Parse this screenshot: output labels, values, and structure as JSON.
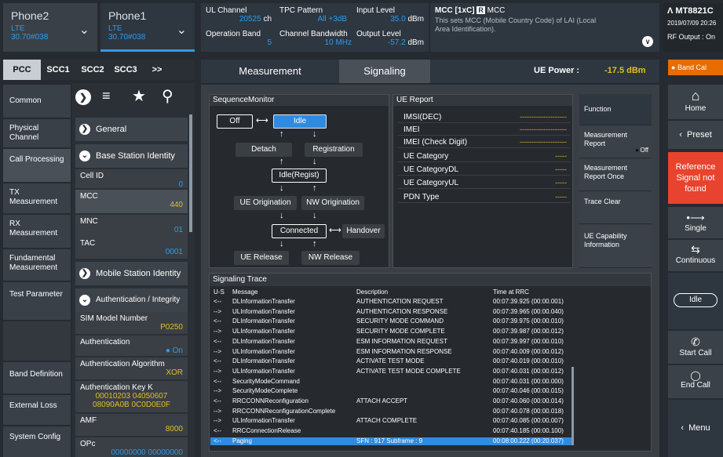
{
  "phones": [
    {
      "name": "Phone2",
      "rat": "LTE",
      "band": "30.70#038"
    },
    {
      "name": "Phone1",
      "rat": "LTE",
      "band": "30.70#038"
    }
  ],
  "header": {
    "ul_channel_label": "UL Channel",
    "ul_channel_value": "20525",
    "ul_channel_unit": "ch",
    "operation_band_label": "Operation Band",
    "operation_band_value": "5",
    "tpc_label": "TPC Pattern",
    "tpc_value": "All +3dB",
    "ch_bw_label": "Channel Bandwidth",
    "ch_bw_value": "10 MHz",
    "input_level_label": "Input Level",
    "input_level_value": "35.0",
    "input_level_unit": "dBm",
    "output_level_label": "Output Level",
    "output_level_value": "-57.2",
    "output_level_unit": "dBm",
    "help_title": "MCC [1xC]",
    "help_badge": "R",
    "help_title2": "MCC",
    "help_text": "This sets MCC (Mobile Country Code) of LAI (Local Area Identification).",
    "model": "MT8821C",
    "datetime": "2019/07/09 20:26",
    "rf_output": "RF Output : On"
  },
  "cc_tabs": [
    "PCC",
    "SCC1",
    "SCC2",
    "SCC3",
    ">>"
  ],
  "categories": [
    "Common",
    "Physical Channel",
    "Call Processing",
    "TX Measurement",
    "RX Measurement",
    "Fundamental Measurement",
    "Test Parameter",
    "Band Definition",
    "External Loss",
    "System Config"
  ],
  "settings": {
    "general": "General",
    "bsi": "Base Station Identity",
    "cell_id_label": "Cell ID",
    "cell_id": "0",
    "mcc_label": "MCC",
    "mcc": "440",
    "mnc_label": "MNC",
    "mnc": "01",
    "tac_label": "TAC",
    "tac": "0001",
    "msi": "Mobile Station Identity",
    "auth": "Authentication / Integrity",
    "sim_label": "SIM Model Number",
    "sim": "P0250",
    "authn_label": "Authentication",
    "authn": "On",
    "alg_label": "Authentication Algorithm",
    "alg": "XOR",
    "key_label": "Authentication Key K",
    "key1": "00010203 04050607",
    "key2": "08090A0B 0C0D0E0F",
    "amf_label": "AMF",
    "amf": "8000",
    "opc_label": "OPc",
    "opc": "00000000 00000000"
  },
  "main_tabs": {
    "measurement": "Measurement",
    "signaling": "Signaling",
    "ue_power_label": "UE Power :",
    "ue_power_value": "-17.5 dBm"
  },
  "sequence": {
    "title": "SequenceMonitor",
    "off": "Off",
    "idle": "Idle",
    "detach": "Detach",
    "registration": "Registration",
    "idle_regist": "Idle(Regist)",
    "ue_orig": "UE Origination",
    "nw_orig": "NW Origination",
    "connected": "Connected",
    "handover": "Handover",
    "ue_release": "UE Release",
    "nw_release": "NW Release"
  },
  "ue_report": {
    "title": "UE Report",
    "rows": [
      {
        "k": "IMSI(DEC)",
        "v": "--------------------"
      },
      {
        "k": "IMEI",
        "v": "--------------------"
      },
      {
        "k": "IMEI (Check Digit)",
        "v": "--------------------"
      },
      {
        "k": "UE Category",
        "v": "-----"
      },
      {
        "k": "UE CategoryDL",
        "v": "-----"
      },
      {
        "k": "UE CategoryUL",
        "v": "-----"
      },
      {
        "k": "PDN Type",
        "v": "-----"
      }
    ]
  },
  "functions": {
    "function": "Function",
    "meas_report": "Measurement Report",
    "meas_report_state": "Off",
    "meas_once": "Measurement Report Once",
    "trace_clear": "Trace Clear",
    "ue_cap": "UE Capability Information"
  },
  "trace": {
    "title": "Signaling Trace",
    "headers": [
      "U-S",
      "Message",
      "Description",
      "Time at RRC"
    ],
    "rows": [
      [
        "<--",
        "DLInformationTransfer",
        "AUTHENTICATION REQUEST",
        "00:07:39.925 (00:00.001)"
      ],
      [
        "-->",
        "ULInformationTransfer",
        "AUTHENTICATION RESPONSE",
        "00:07:39.965 (00:00.040)"
      ],
      [
        "<--",
        "DLInformationTransfer",
        "SECURITY MODE COMMAND",
        "00:07:39.975 (00:00.010)"
      ],
      [
        "-->",
        "ULInformationTransfer",
        "SECURITY MODE COMPLETE",
        "00:07:39.987 (00:00.012)"
      ],
      [
        "<--",
        "DLInformationTransfer",
        "ESM INFORMATION REQUEST",
        "00:07:39.997 (00:00.010)"
      ],
      [
        "-->",
        "ULInformationTransfer",
        "ESM INFORMATION RESPONSE",
        "00:07:40.009 (00:00.012)"
      ],
      [
        "<--",
        "DLInformationTransfer",
        "ACTIVATE TEST MODE",
        "00:07:40.019 (00:00.010)"
      ],
      [
        "-->",
        "ULInformationTransfer",
        "ACTIVATE TEST MODE COMPLETE",
        "00:07:40.031 (00:00.012)"
      ],
      [
        "<--",
        "SecurityModeCommand",
        "",
        "00:07:40.031 (00:00.000)"
      ],
      [
        "-->",
        "SecurityModeComplete",
        "",
        "00:07:40.046 (00:00.015)"
      ],
      [
        "<--",
        "RRCCONNReconfiguration",
        "ATTACH ACCEPT",
        "00:07:40.060 (00:00.014)"
      ],
      [
        "-->",
        "RRCCONNReconfigurationComplete",
        "",
        "00:07:40.078 (00:00.018)"
      ],
      [
        "-->",
        "ULInformationTransfer",
        "ATTACH COMPLETE",
        "00:07:40.085 (00:00.007)"
      ],
      [
        "<--",
        "RRCConnectionRelease",
        "",
        "00:07:40.185 (00:00.100)"
      ],
      [
        "<--",
        "Paging",
        "SFN : 917  Subframe : 9",
        "00:08:00.222 (00:20.037)"
      ]
    ]
  },
  "right": {
    "band_cal": "Band Cal",
    "home": "Home",
    "preset": "Preset",
    "ref_signal": "Reference Signal not found",
    "single": "Single",
    "continuous": "Continuous",
    "idle": "Idle",
    "start_call": "Start Call",
    "end_call": "End Call",
    "menu": "Menu"
  }
}
